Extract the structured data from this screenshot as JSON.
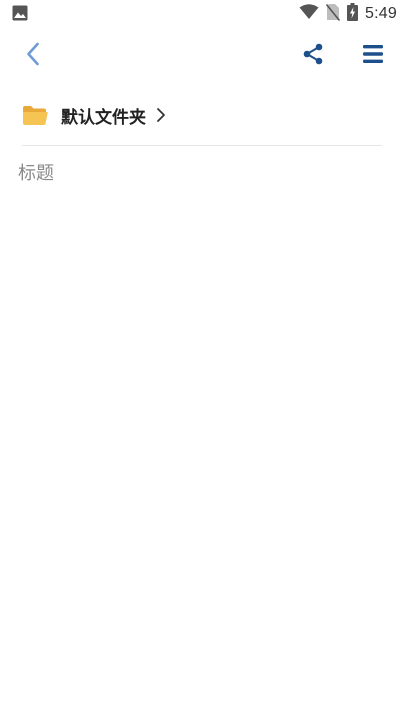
{
  "status_bar": {
    "time": "5:49",
    "icons": [
      "image-notification-icon",
      "wifi-icon",
      "no-sim-icon",
      "battery-charging-icon"
    ]
  },
  "toolbar": {
    "back_icon": "chevron-left-icon",
    "share_icon": "share-icon",
    "menu_icon": "hamburger-menu-icon"
  },
  "folder": {
    "name": "默认文件夹",
    "icon": "folder-icon"
  },
  "note": {
    "title_placeholder": "标题",
    "title_value": ""
  },
  "colors": {
    "accent_light": "#6f9bd6",
    "accent_dark": "#1d4f8c",
    "folder_yellow": "#f6c453",
    "text_dark": "#222222",
    "placeholder": "#8a8a8a",
    "divider": "#e6e6e6"
  }
}
